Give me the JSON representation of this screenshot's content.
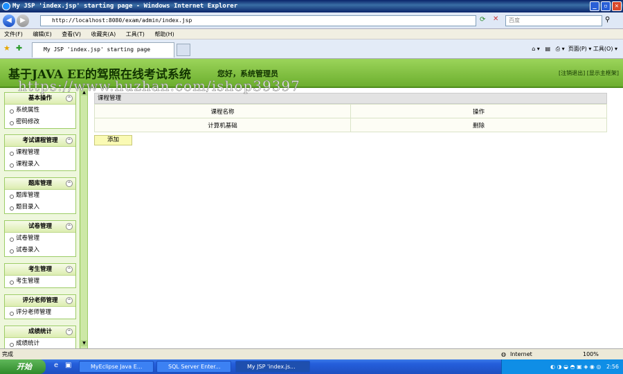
{
  "window": {
    "title": "My JSP 'index.jsp' starting page - Windows Internet Explorer",
    "address": "http://localhost:8080/exam/admin/index.jsp",
    "search_placeholder": "百度",
    "menu": [
      "文件(F)",
      "编辑(E)",
      "查看(V)",
      "收藏夹(A)",
      "工具(T)",
      "帮助(H)"
    ],
    "tab_title": "My JSP 'index.jsp' starting page",
    "tab_tools": "页面(P) ▾   工具(O) ▾"
  },
  "header": {
    "system_name": "基于JAVA EE的驾照在线考试系统",
    "greeting": "您好，系统管理员",
    "links": "[注销退出] [显示主框架]",
    "watermark": "https://www.huzhan.com/ishop39397"
  },
  "sidebar": {
    "groups": [
      {
        "title": "基本操作",
        "items": [
          "系统属性",
          "密码修改"
        ]
      },
      {
        "title": "考试课程管理",
        "items": [
          "课程管理",
          "课程录入"
        ]
      },
      {
        "title": "题库管理",
        "items": [
          "题库管理",
          "题目录入"
        ]
      },
      {
        "title": "试卷管理",
        "items": [
          "试卷管理",
          "试卷录入"
        ]
      },
      {
        "title": "考生管理",
        "items": [
          "考生管理"
        ]
      },
      {
        "title": "评分老师管理",
        "items": [
          "评分老师管理"
        ]
      },
      {
        "title": "成绩统计",
        "items": [
          "成绩统计"
        ]
      }
    ]
  },
  "content": {
    "panel_title": "课程管理",
    "columns": [
      "课程名称",
      "操作"
    ],
    "rows": [
      {
        "name": "计算机基础",
        "action": "删除"
      }
    ],
    "add_label": "添加"
  },
  "statusbar": {
    "left": "完成",
    "zone": "Internet",
    "zoom": "100%"
  },
  "taskbar": {
    "start": "开始",
    "tasks": [
      "MyEclipse Java E...",
      "SQL Server Enter...",
      "My JSP 'index.js..."
    ],
    "clock": "2:56"
  }
}
